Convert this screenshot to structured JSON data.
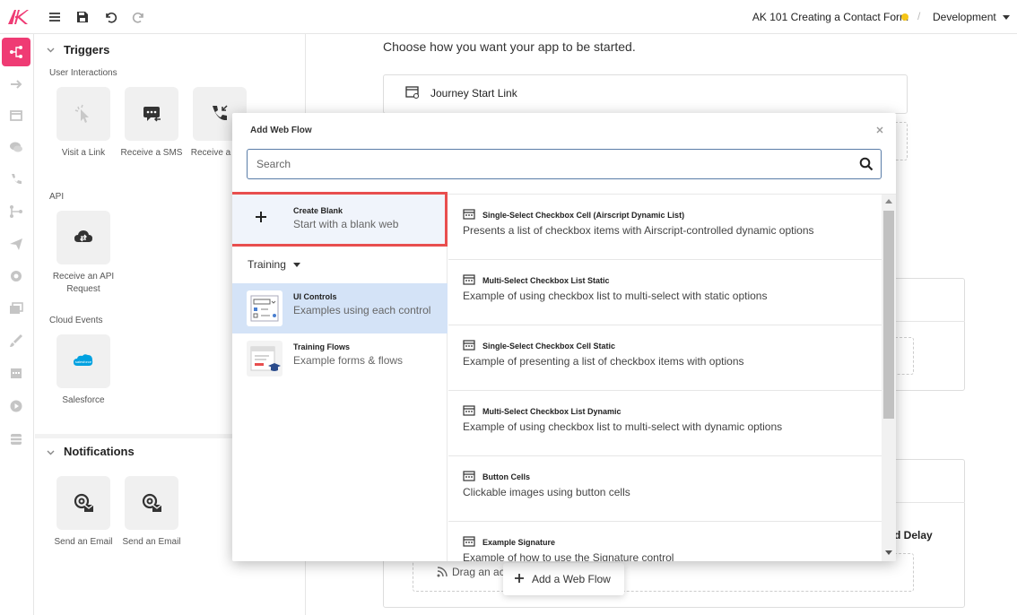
{
  "app": {
    "title": "AK 101 Creating a Contact Form",
    "environment": "Development",
    "status_color": "#f5c518",
    "brand_color": "#ef3b74",
    "logo_text": "AK"
  },
  "toolbar": {
    "icons": [
      "menu-icon",
      "save-icon",
      "undo-icon",
      "redo-icon"
    ]
  },
  "rail": {
    "icons": [
      "flow-icon",
      "arrow-right-icon",
      "page-icon",
      "chat-icon",
      "phone-icon",
      "branch-icon",
      "send-icon",
      "settings-icon",
      "cards-icon",
      "brush-icon",
      "calendar-icon",
      "play-icon",
      "database-icon"
    ]
  },
  "triggers": {
    "heading": "Triggers",
    "user_interactions_label": "User Interactions",
    "user_interactions": [
      {
        "label": "Visit a Link",
        "icon": "pointer-icon"
      },
      {
        "label": "Receive a SMS",
        "icon": "sms-icon"
      },
      {
        "label": "Receive a Call",
        "icon": "phone-call-icon"
      }
    ],
    "api_label": "API",
    "api": [
      {
        "label": "Receive an API Request",
        "icon": "cloud-sync-icon"
      }
    ],
    "cloud_label": "Cloud Events",
    "cloud": [
      {
        "label": "Salesforce",
        "icon": "salesforce-icon"
      }
    ]
  },
  "notifications": {
    "heading": "Notifications",
    "items": [
      {
        "label": "Send an Email",
        "icon": "email-icon"
      },
      {
        "label": "Send an Email",
        "icon": "email-icon"
      }
    ]
  },
  "main": {
    "prompt": "Choose how you want your app to be started.",
    "journey_link": "Journey Start Link",
    "delay_fragment": "d Delay",
    "drag_text": "Drag an ac                                           ne.",
    "add_web_flow": "Add a Web Flow"
  },
  "modal": {
    "title": "Add Web Flow",
    "search_placeholder": "Search",
    "create_blank": {
      "title": "Create Blank",
      "subtitle": "Start with a blank web"
    },
    "training_label": "Training",
    "categories": [
      {
        "title": "UI Controls",
        "subtitle": "Examples using each control",
        "selected": true
      },
      {
        "title": "Training Flows",
        "subtitle": "Example forms & flows",
        "selected": false
      }
    ],
    "templates": [
      {
        "title": "Single-Select Checkbox Cell (Airscript Dynamic List)",
        "desc": "Presents a list of checkbox items with Airscript-controlled dynamic options"
      },
      {
        "title": "Multi-Select Checkbox List Static",
        "desc": "Example of using checkbox list to multi-select with static options"
      },
      {
        "title": "Single-Select Checkbox Cell Static",
        "desc": "Example of presenting a list of checkbox items with options"
      },
      {
        "title": "Multi-Select Checkbox List Dynamic",
        "desc": "Example of using checkbox list to multi-select with dynamic options"
      },
      {
        "title": "Button Cells",
        "desc": "Clickable images using button cells"
      },
      {
        "title": "Example Signature",
        "desc": "Example of how to use the Signature control"
      }
    ]
  }
}
